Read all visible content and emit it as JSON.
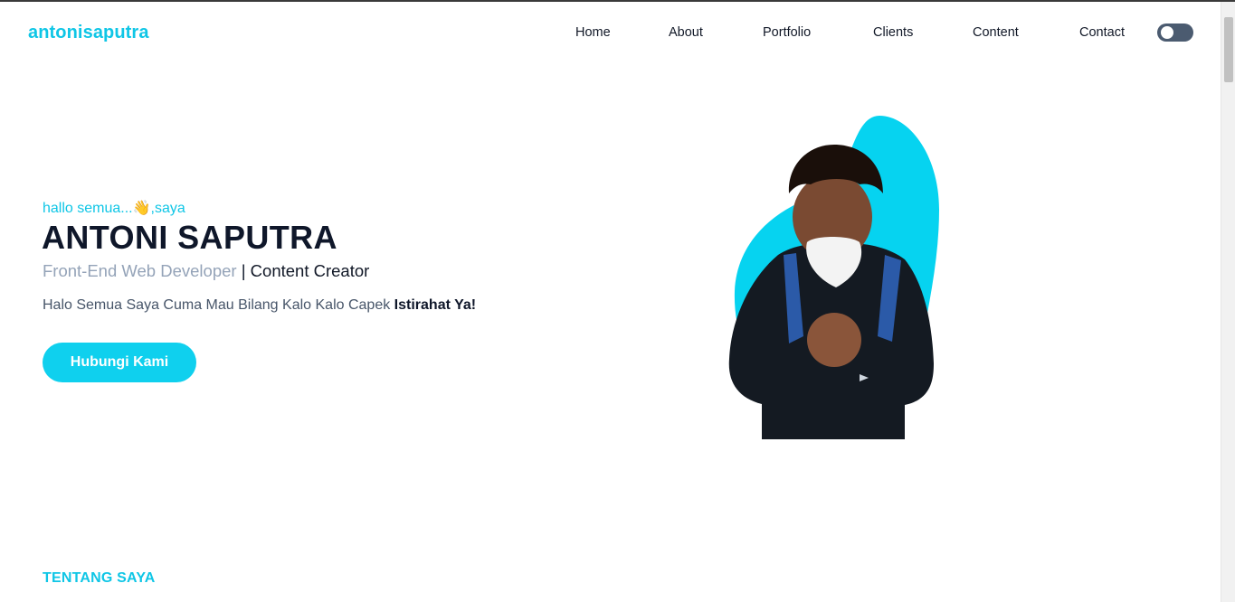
{
  "brand": "antonisaputra",
  "nav": {
    "items": [
      {
        "label": "Home"
      },
      {
        "label": "About"
      },
      {
        "label": "Portfolio"
      },
      {
        "label": "Clients"
      },
      {
        "label": "Content"
      },
      {
        "label": "Contact"
      }
    ],
    "theme_toggle": {
      "state": "off",
      "icon": "toggle-switch-icon"
    }
  },
  "hero": {
    "greeting": "hallo semua...",
    "greeting_emoji": "👋",
    "greeting_suffix": ",saya",
    "name": "ANTONI SAPUTRA",
    "role_primary": "Front-End Web Developer",
    "role_separator": "|",
    "role_secondary": "Content Creator",
    "description": "Halo Semua Saya Cuma Mau Bilang Kalo Kalo Capek",
    "description_bold": "Istirahat Ya!",
    "cta_label": "Hubungi Kami",
    "photo_icon": "profile-photo"
  },
  "about": {
    "section_label": "TENTANG SAYA"
  },
  "colors": {
    "accent": "#0fc6e6",
    "button": "#0fd0ee",
    "blob": "#06d3f0",
    "toggle": "#4b5b70",
    "heading": "#0f172a",
    "muted": "#94a3b8"
  }
}
